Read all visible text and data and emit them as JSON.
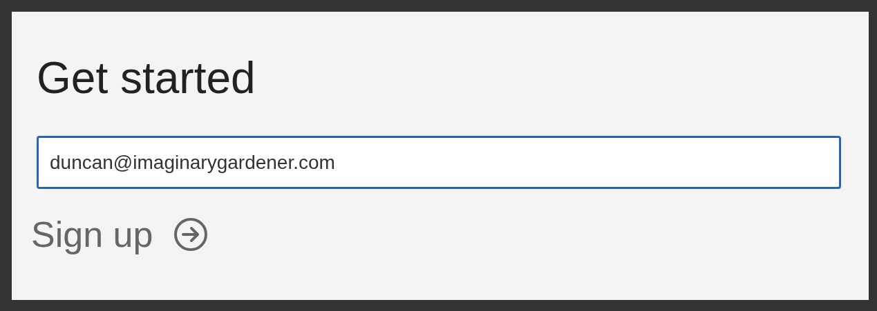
{
  "title": "Get started",
  "email_field": {
    "value": "duncan@imaginarygardener.com",
    "focused": true
  },
  "sign_up_button": {
    "label": "Sign up"
  }
}
